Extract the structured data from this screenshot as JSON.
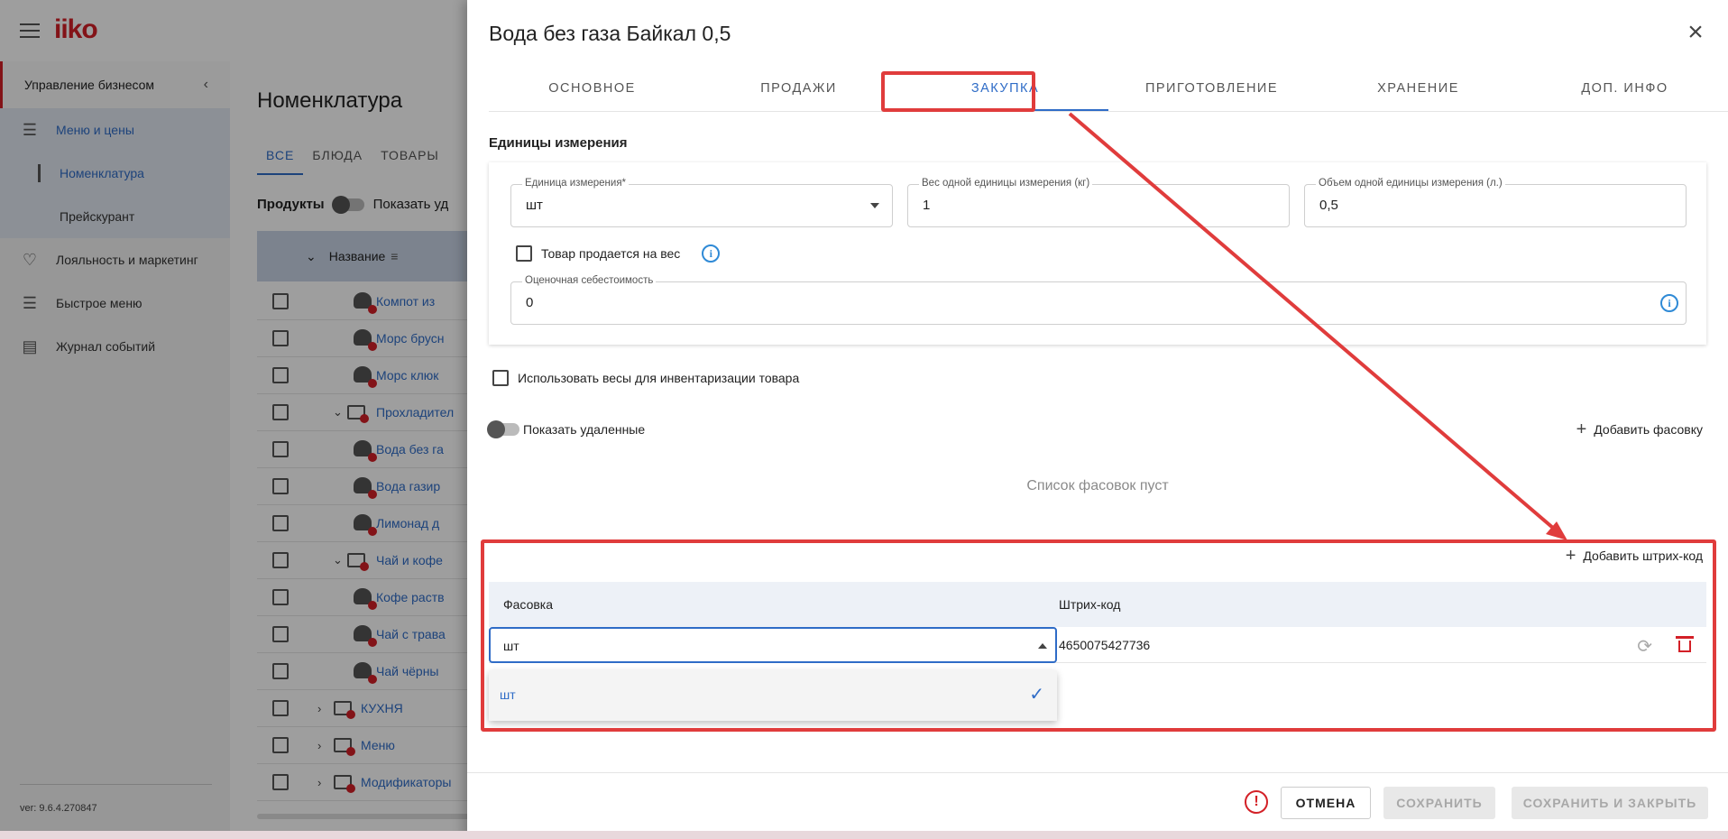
{
  "app": {
    "logo": "iiko",
    "version": "ver: 9.6.4.270847"
  },
  "sidebar": {
    "section_title": "Управление бизнесом",
    "items": [
      {
        "label": "Меню и цены",
        "icon": "list-icon",
        "active": true
      },
      {
        "label": "Лояльность и маркетинг",
        "icon": "heart-icon",
        "active": false
      },
      {
        "label": "Быстрое меню",
        "icon": "list-icon",
        "active": false
      },
      {
        "label": "Журнал событий",
        "icon": "journal-icon",
        "active": false
      }
    ],
    "subitems": [
      {
        "label": "Номенклатура",
        "active": true
      },
      {
        "label": "Прейскурант",
        "active": false
      }
    ]
  },
  "main": {
    "title": "Номенклатура",
    "tabs": [
      "ВСЕ",
      "БЛЮДА",
      "ТОВАРЫ"
    ],
    "products_label": "Продукты",
    "show_deleted_partial": "Показать уд",
    "column_name": "Название",
    "rows": [
      {
        "label": "Компот из",
        "type": "dish",
        "level": 2
      },
      {
        "label": "Морс брусн",
        "type": "dish",
        "level": 2
      },
      {
        "label": "Морс клюк",
        "type": "dish",
        "level": 2
      },
      {
        "label": "Прохладител",
        "type": "folder",
        "level": 1,
        "expanded": true
      },
      {
        "label": "Вода без га",
        "type": "dish",
        "level": 2
      },
      {
        "label": "Вода газир",
        "type": "dish",
        "level": 2
      },
      {
        "label": "Лимонад д",
        "type": "dish",
        "level": 2
      },
      {
        "label": "Чай и кофе",
        "type": "folder",
        "level": 1,
        "expanded": true
      },
      {
        "label": "Кофе раств",
        "type": "dish",
        "level": 2
      },
      {
        "label": "Чай с трава",
        "type": "dish",
        "level": 2
      },
      {
        "label": "Чай чёрны",
        "type": "dish",
        "level": 2
      },
      {
        "label": "КУХНЯ",
        "type": "folder",
        "level": 0,
        "expanded": false
      },
      {
        "label": "Меню",
        "type": "folder",
        "level": 0,
        "expanded": false
      },
      {
        "label": "Модификаторы",
        "type": "folder",
        "level": 0,
        "expanded": false
      }
    ]
  },
  "dialog": {
    "title": "Вода без газа Байкал 0,5",
    "tabs": [
      "ОСНОВНОЕ",
      "ПРОДАЖИ",
      "ЗАКУПКА",
      "ПРИГОТОВЛЕНИЕ",
      "ХРАНЕНИЕ",
      "ДОП. ИНФО"
    ],
    "active_tab": "ЗАКУПКА",
    "units_section": "Единицы измерения",
    "unit_label": "Единица измерения*",
    "unit_value": "шт",
    "weight_label": "Вес одной единицы измерения (кг)",
    "weight_value": "1",
    "volume_label": "Объем одной единицы измерения (л.)",
    "volume_value": "0,5",
    "sold_by_weight": "Товар продается на вес",
    "cost_label": "Оценочная себестоимость",
    "cost_value": "0",
    "use_scales": "Использовать весы для инвентаризации товара",
    "show_deleted": "Показать удаленные",
    "add_package": "Добавить фасовку",
    "packages_empty": "Список фасовок пуст",
    "add_barcode": "Добавить штрих-код",
    "barcode_table": {
      "col_package": "Фасовка",
      "col_barcode": "Штрих-код",
      "row_package": "шт",
      "row_barcode": "4650075427736"
    },
    "dropdown_option": "шт",
    "buttons": {
      "cancel": "ОТМЕНА",
      "save": "СОХРАНИТЬ",
      "save_close": "СОХРАНИТЬ И ЗАКРЫТЬ"
    }
  },
  "colors": {
    "accent": "#2f6cc7",
    "brand": "#d32027",
    "annotation": "#e03c3c"
  }
}
